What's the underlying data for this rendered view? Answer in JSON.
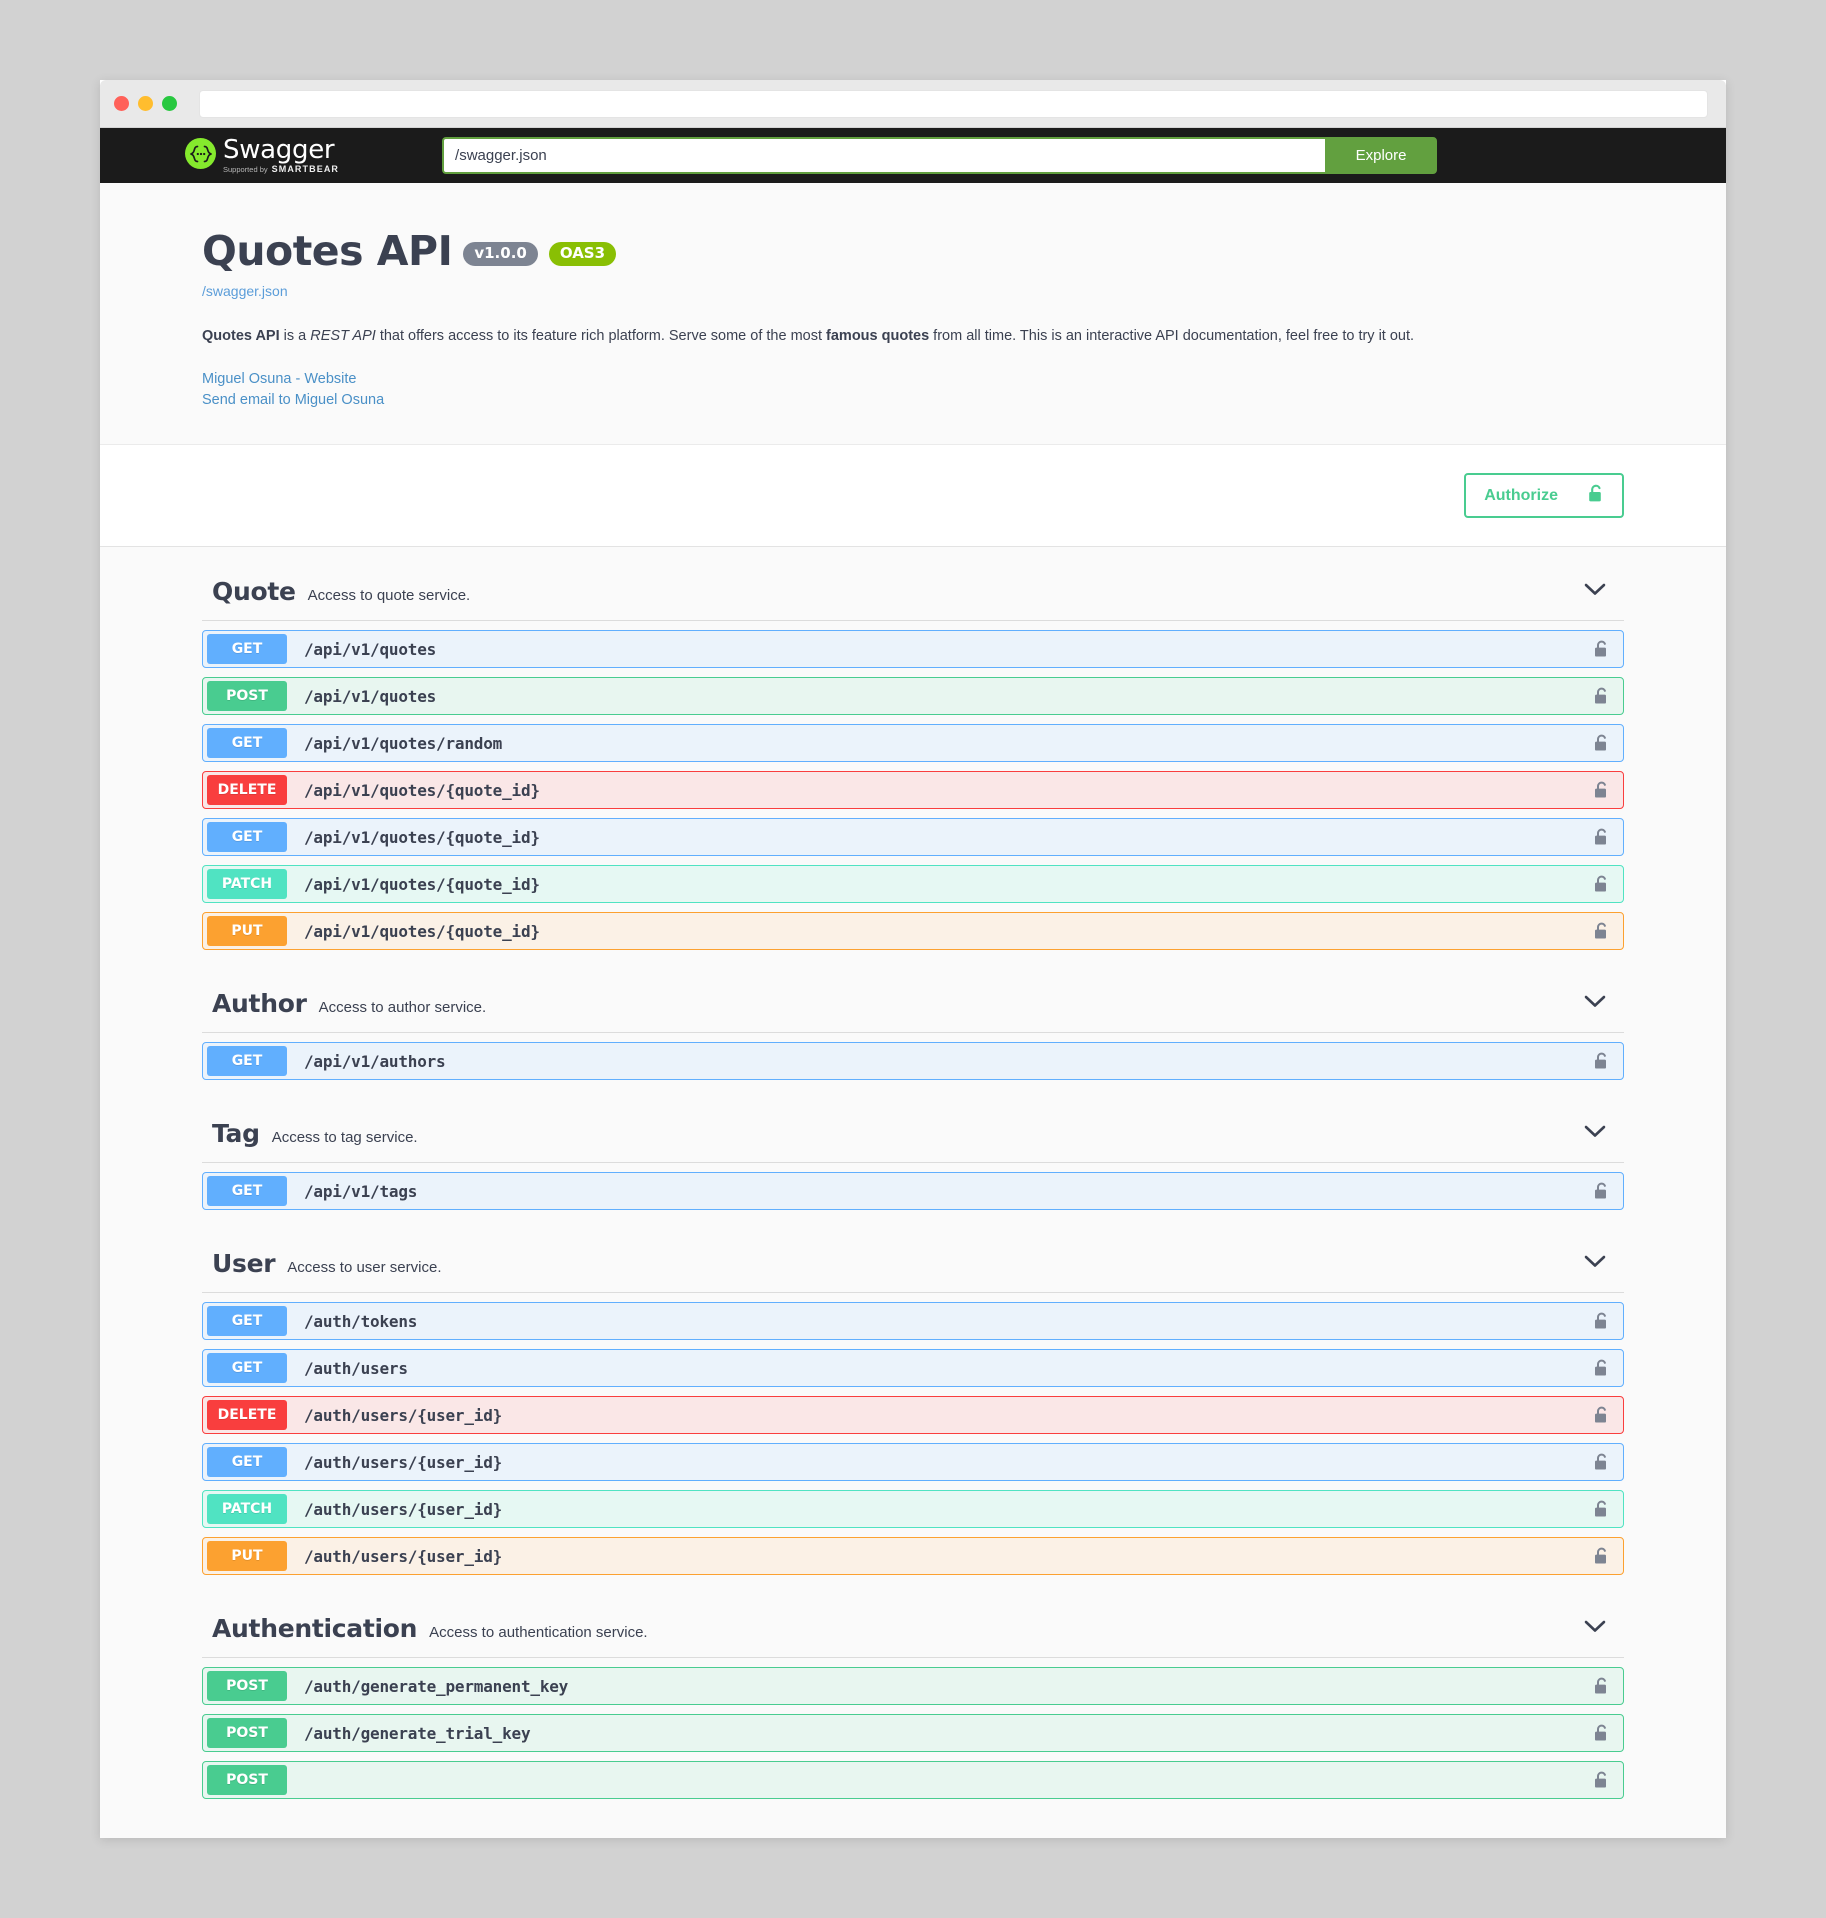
{
  "browser": {
    "traffic_lights": [
      "close",
      "minimize",
      "maximize"
    ],
    "address_value": ""
  },
  "topbar": {
    "logo_text": "Swagger",
    "logo_supported_prefix": "Supported by",
    "logo_supported_brand": "SMARTBEAR",
    "spec_url_value": "/swagger.json",
    "spec_url_placeholder": "/swagger.json",
    "explore_label": "Explore"
  },
  "info": {
    "title": "Quotes API",
    "version_badge": "v1.0.0",
    "oas_badge": "OAS3",
    "spec_link": "/swagger.json",
    "description_parts": {
      "bold1": "Quotes API",
      "text1": " is a ",
      "italic1": "REST API",
      "text2": " that offers access to its feature rich platform. Serve some of the most ",
      "bold2": "famous quotes",
      "text3": " from all time. This is an interactive API documentation, feel free to try it out."
    },
    "website_link": "Miguel Osuna - Website",
    "email_link": "Send email to Miguel Osuna"
  },
  "auth": {
    "authorize_label": "Authorize",
    "lock_icon": "unlock-icon"
  },
  "colors": {
    "get": "#61affe",
    "post": "#49cc90",
    "delete": "#f93e3e",
    "patch": "#50e3c2",
    "put": "#fca130",
    "brand_green": "#85ea2d",
    "explore_green": "#62a03f",
    "authorize_green": "#49cc90",
    "oas_badge_green": "#89bf04",
    "version_badge_gray": "#7d8492"
  },
  "tags": [
    {
      "name": "Quote",
      "description": "Access to quote service.",
      "operations": [
        {
          "method": "GET",
          "path": "/api/v1/quotes"
        },
        {
          "method": "POST",
          "path": "/api/v1/quotes"
        },
        {
          "method": "GET",
          "path": "/api/v1/quotes/random"
        },
        {
          "method": "DELETE",
          "path": "/api/v1/quotes/{quote_id}"
        },
        {
          "method": "GET",
          "path": "/api/v1/quotes/{quote_id}"
        },
        {
          "method": "PATCH",
          "path": "/api/v1/quotes/{quote_id}"
        },
        {
          "method": "PUT",
          "path": "/api/v1/quotes/{quote_id}"
        }
      ]
    },
    {
      "name": "Author",
      "description": "Access to author service.",
      "operations": [
        {
          "method": "GET",
          "path": "/api/v1/authors"
        }
      ]
    },
    {
      "name": "Tag",
      "description": "Access to tag service.",
      "operations": [
        {
          "method": "GET",
          "path": "/api/v1/tags"
        }
      ]
    },
    {
      "name": "User",
      "description": "Access to user service.",
      "operations": [
        {
          "method": "GET",
          "path": "/auth/tokens"
        },
        {
          "method": "GET",
          "path": "/auth/users"
        },
        {
          "method": "DELETE",
          "path": "/auth/users/{user_id}"
        },
        {
          "method": "GET",
          "path": "/auth/users/{user_id}"
        },
        {
          "method": "PATCH",
          "path": "/auth/users/{user_id}"
        },
        {
          "method": "PUT",
          "path": "/auth/users/{user_id}"
        }
      ]
    },
    {
      "name": "Authentication",
      "description": "Access to authentication service.",
      "operations": [
        {
          "method": "POST",
          "path": "/auth/generate_permanent_key"
        },
        {
          "method": "POST",
          "path": "/auth/generate_trial_key"
        },
        {
          "method": "POST",
          "path": ""
        }
      ]
    }
  ]
}
